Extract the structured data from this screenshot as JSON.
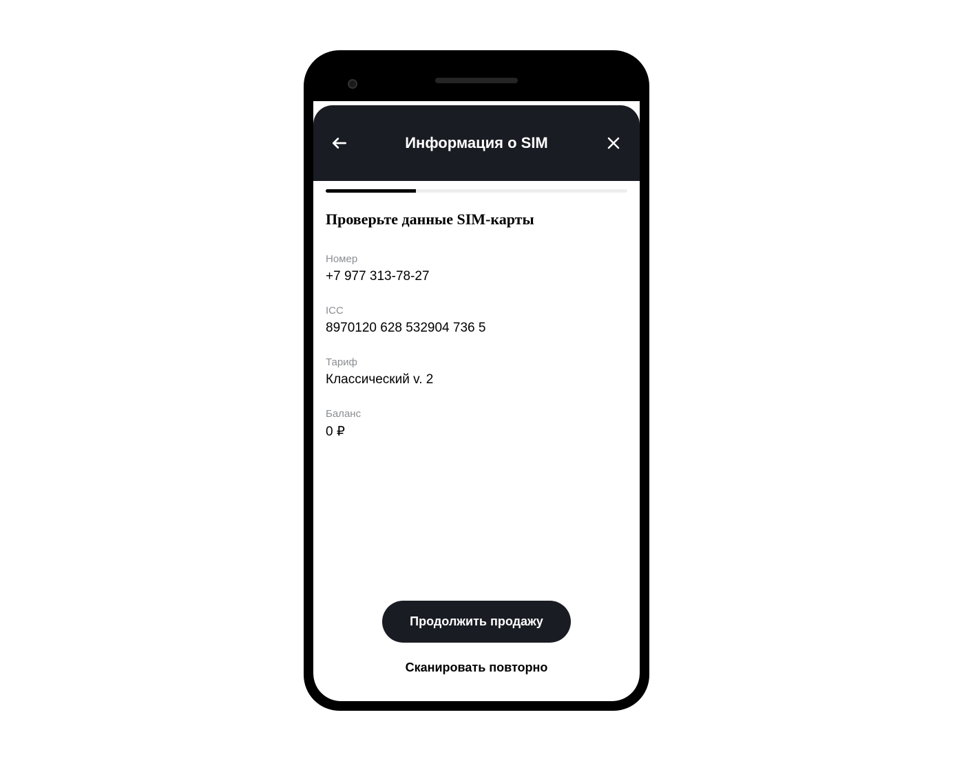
{
  "header": {
    "title": "Информация о SIM"
  },
  "progress": {
    "percent": 30
  },
  "page": {
    "title": "Проверьте данные SIM-карты"
  },
  "fields": {
    "number": {
      "label": "Номер",
      "value": "+7 977 313-78-27"
    },
    "icc": {
      "label": "ICC",
      "value": "8970120 628 532904 736 5"
    },
    "tariff": {
      "label": "Тариф",
      "value": "Классический v. 2"
    },
    "balance": {
      "label": "Баланс",
      "value": "0 ₽"
    }
  },
  "actions": {
    "continue_label": "Продолжить продажу",
    "rescan_label": "Сканировать повторно"
  }
}
